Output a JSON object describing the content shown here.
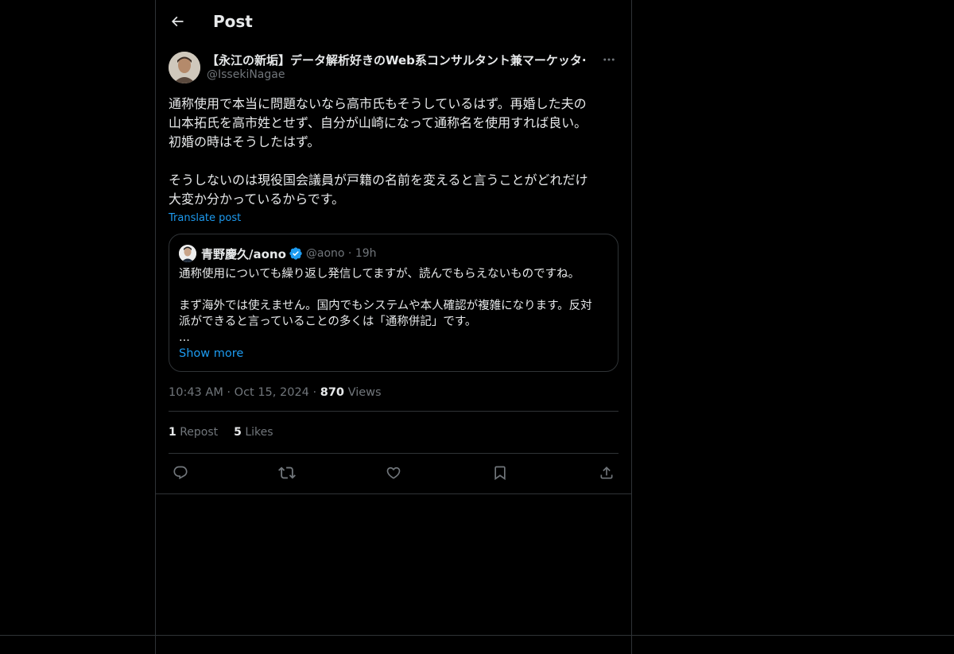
{
  "header": {
    "title": "Post"
  },
  "post": {
    "author_name": "【永江の新垢】データ解析好きのWeb系コンサルタント兼マーケッタ·",
    "author_handle": "@IssekiNagae",
    "text": "通称使用で本当に問題ないなら高市氏もそうしているはず。再婚した夫の\n山本拓氏を高市姓とせず、自分が山崎になって通称名を使用すれば良い。\n初婚の時はそうしたはず。\n\nそうしないのは現役国会議員が戸籍の名前を変えると言うことがどれだけ\n大変か分かっているからです。",
    "translate_label": "Translate post",
    "quote": {
      "name": "青野慶久/aono",
      "handle_time": "@aono · 19h",
      "text": "通称使用についても繰り返し発信してますが、読んでもらえないものですね。\n\nまず海外では使えません。国内でもシステムや本人確認が複雑になります。反対\n派ができると言っていることの多くは「通称併記」です。\n...",
      "show_more": "Show more"
    },
    "timestamp": "10:43 AM · Oct 15, 2024 · ",
    "views_count": "870",
    "views_label": " Views",
    "reposts_count": "1",
    "reposts_label": " Repost",
    "likes_count": "5",
    "likes_label": " Likes"
  },
  "colors": {
    "background": "#000000",
    "accent": "#1d9bf0",
    "muted": "#71767b",
    "border": "#2f3336"
  }
}
